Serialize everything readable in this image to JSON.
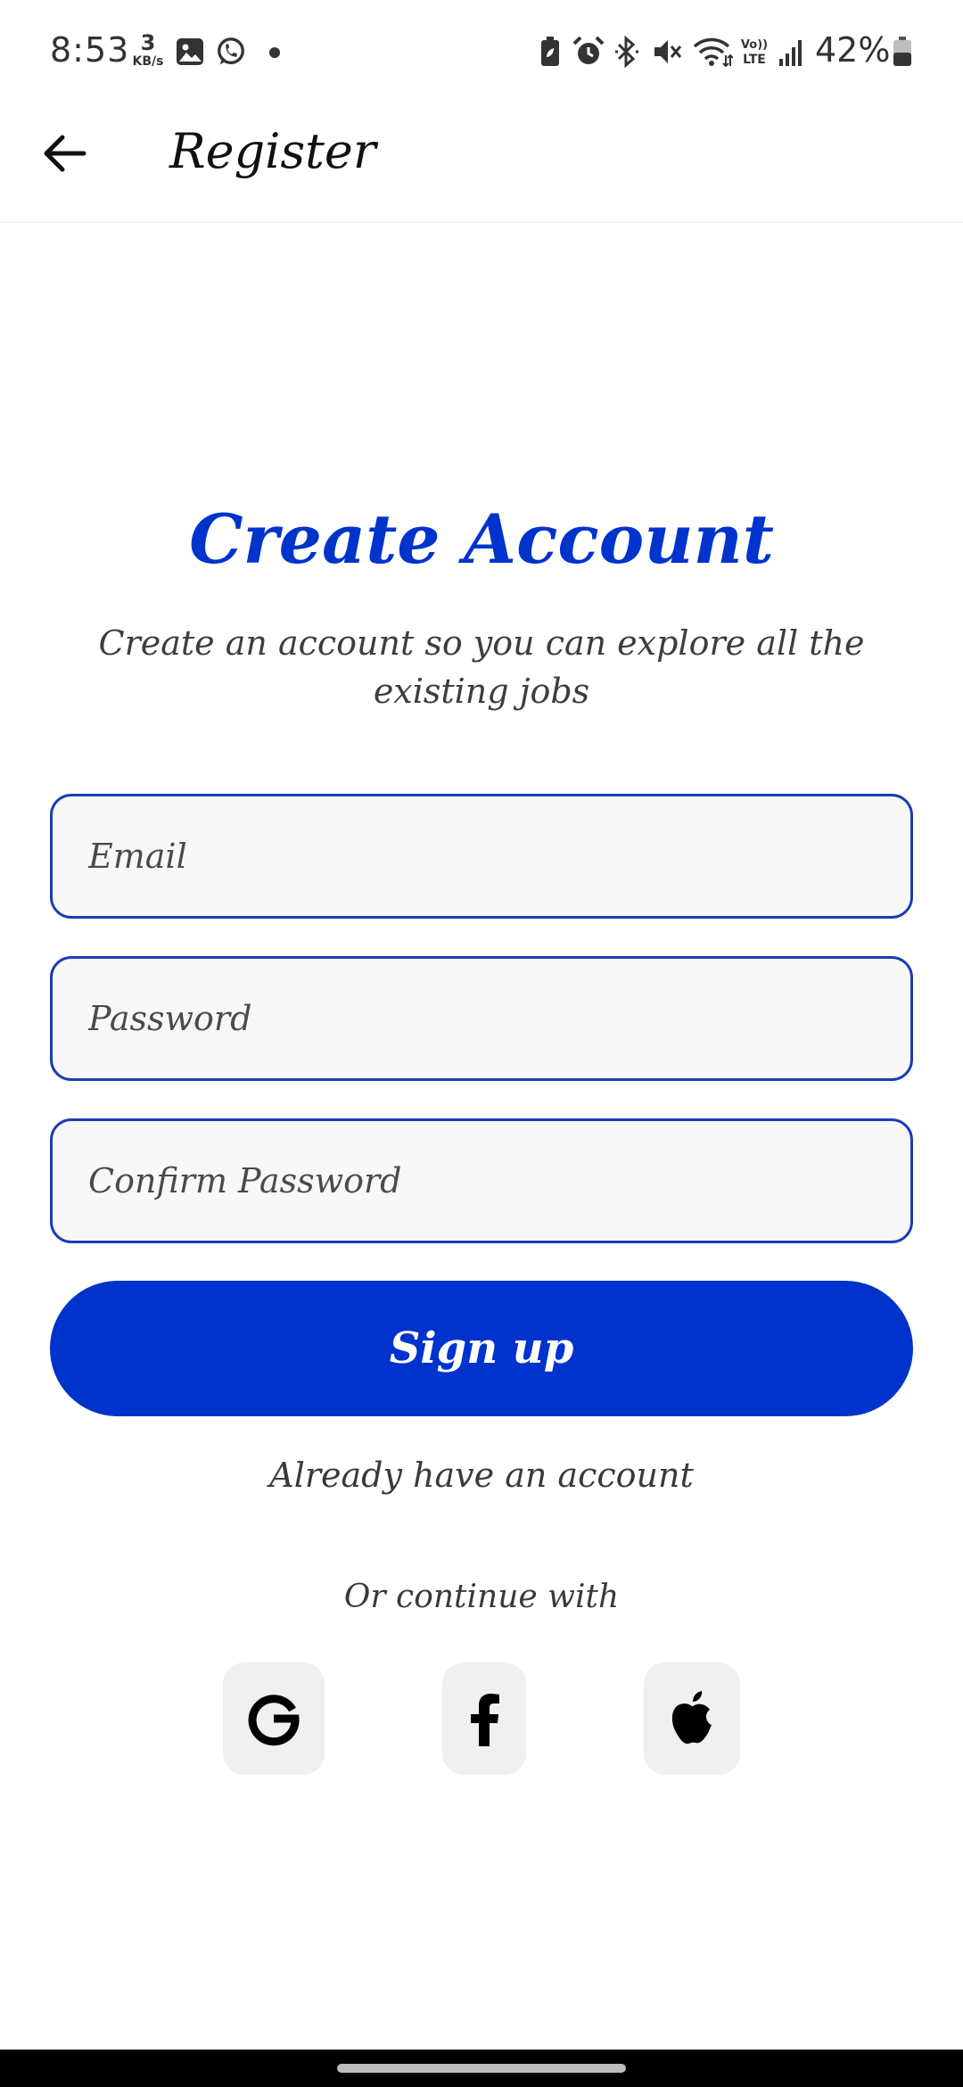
{
  "status_bar": {
    "time": "8:53",
    "speed_value": "3",
    "speed_unit": "KB/s",
    "battery": "42%",
    "icons": [
      "gallery-icon",
      "whatsapp-icon",
      "dot-icon",
      "battery-saver-icon",
      "alarm-icon",
      "bluetooth-icon",
      "mute-icon",
      "wifi-icon",
      "volte-icon",
      "signal-icon",
      "battery-icon"
    ]
  },
  "app_bar": {
    "title": "Register",
    "back_icon": "arrow-left-icon"
  },
  "main": {
    "headline": "Create Account",
    "subtitle": "Create an account so you can explore all the existing jobs",
    "email_placeholder": "Email",
    "password_placeholder": "Password",
    "confirm_placeholder": "Confirm Password",
    "signup_label": "Sign up",
    "login_link": "Already have an account",
    "or_continue": "Or continue with",
    "social": [
      "google-icon",
      "facebook-icon",
      "apple-icon"
    ]
  },
  "colors": {
    "accent": "#0033cc",
    "field_border": "#1a3db3",
    "field_bg": "#f8f8f8",
    "social_bg": "#f0f0f0",
    "text": "#3a3a3a"
  }
}
